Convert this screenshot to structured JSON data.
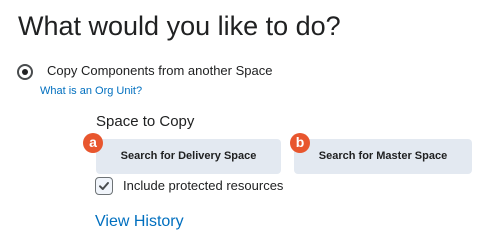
{
  "heading": "What would you like to do?",
  "option": {
    "label": "Copy Components from another Space",
    "selected": true
  },
  "help_link": "What is an Org Unit?",
  "space_to_copy": {
    "label": "Space to Copy",
    "delivery_button": "Search for Delivery Space",
    "master_button": "Search for Master Space"
  },
  "badges": {
    "a": "a",
    "b": "b",
    "color": "#e8562e"
  },
  "protected": {
    "label": "Include protected resources",
    "checked": true
  },
  "history_link": "View History",
  "colors": {
    "link": "#006fbf",
    "button_bg": "#e3e9f1",
    "text": "#202122"
  }
}
